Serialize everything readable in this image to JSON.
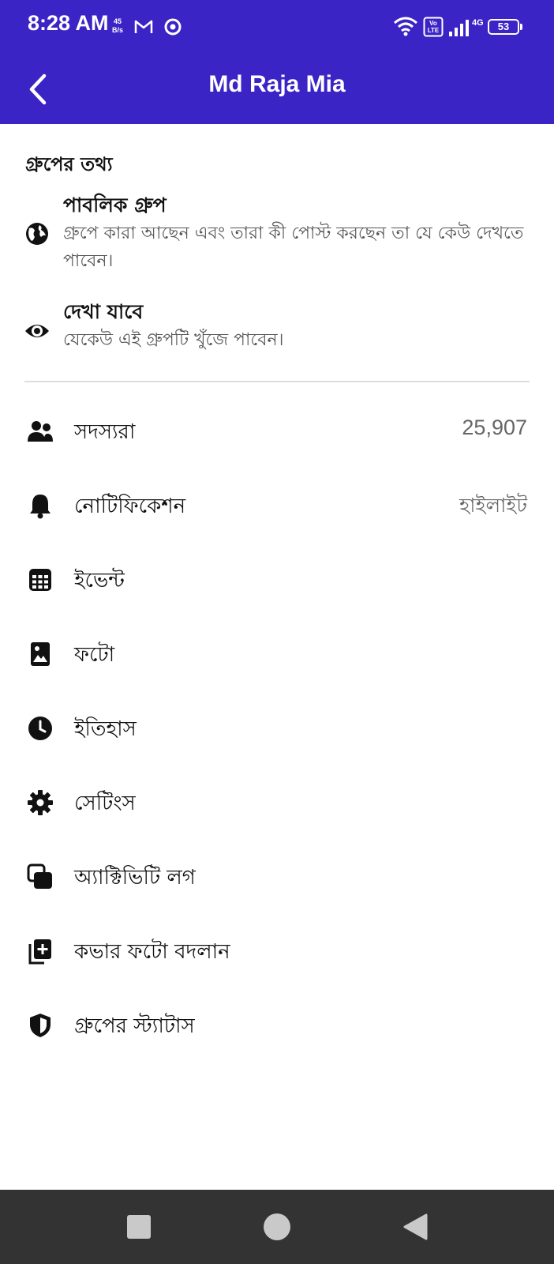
{
  "status_bar": {
    "time": "8:28 AM",
    "net_speed_value": "45",
    "net_speed_unit": "B/s",
    "battery": "53",
    "icons": [
      "gmail-icon",
      "chrome-icon",
      "wifi-icon",
      "volte-icon",
      "signal-icon",
      "4g-icon",
      "battery-icon"
    ]
  },
  "header": {
    "title": "Md Raja Mia",
    "back_icon": "chevron-left-icon"
  },
  "group_info": {
    "heading": "গ্রুপের তথ্য",
    "items": [
      {
        "icon": "globe-icon",
        "title": "পাবলিক গ্রুপ",
        "description": "গ্রুপে কারা আছেন এবং তারা কী পোস্ট করছেন তা যে কেউ দেখতে পাবেন।"
      },
      {
        "icon": "eye-icon",
        "title": "দেখা যাবে",
        "description": "যেকেউ এই গ্রুপটি খুঁজে পাবেন।"
      }
    ]
  },
  "menu": {
    "items": [
      {
        "icon": "members-icon",
        "label": "সদস্যরা",
        "value": "25,907"
      },
      {
        "icon": "bell-icon",
        "label": "নোটিফিকেশন",
        "value": "হাইলাইট"
      },
      {
        "icon": "calendar-icon",
        "label": "ইভেন্ট"
      },
      {
        "icon": "photo-icon",
        "label": "ফটো"
      },
      {
        "icon": "clock-icon",
        "label": "ইতিহাস"
      },
      {
        "icon": "gear-icon",
        "label": "সেটিংস"
      },
      {
        "icon": "activity-log-icon",
        "label": "অ্যাক্টিভিটি লগ"
      },
      {
        "icon": "add-photo-icon",
        "label": "কভার ফটো বদলান"
      },
      {
        "icon": "shield-icon",
        "label": "গ্রুপের স্ট্যাটাস"
      }
    ]
  },
  "nav": {
    "buttons": [
      "recents-square-icon",
      "home-circle-icon",
      "back-triangle-icon"
    ]
  },
  "colors": {
    "header_bg": "#3a24c6",
    "nav_bg": "#333333",
    "text_secondary": "#555555",
    "divider": "#dddddd"
  }
}
